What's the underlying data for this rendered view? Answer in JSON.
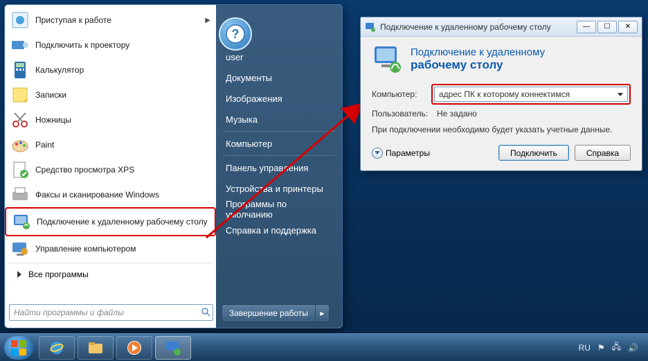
{
  "start_menu": {
    "programs": [
      {
        "label": "Приступая к работе",
        "icon": "getting-started",
        "has_submenu": true
      },
      {
        "label": "Подключить к проектору",
        "icon": "projector"
      },
      {
        "label": "Калькулятор",
        "icon": "calculator"
      },
      {
        "label": "Записки",
        "icon": "sticky-notes"
      },
      {
        "label": "Ножницы",
        "icon": "scissors"
      },
      {
        "label": "Paint",
        "icon": "paint"
      },
      {
        "label": "Средство просмотра XPS",
        "icon": "xps"
      },
      {
        "label": "Факсы и сканирование Windows",
        "icon": "fax"
      },
      {
        "label": "Подключение к удаленному рабочему столу",
        "icon": "rdp",
        "highlight": true
      },
      {
        "label": "Управление компьютером",
        "icon": "mgmt"
      }
    ],
    "all_programs": "Все программы",
    "search_placeholder": "Найти программы и файлы",
    "right_items_top": [
      "user",
      "Документы",
      "Изображения",
      "Музыка"
    ],
    "right_items_mid": [
      "Компьютер"
    ],
    "right_items_bot": [
      "Панель управления",
      "Устройства и принтеры",
      "Программы по умолчанию",
      "Справка и поддержка"
    ],
    "shutdown": "Завершение работы"
  },
  "rdp": {
    "title": "Подключение к удаленному рабочему столу",
    "header_line1": "Подключение к удаленному",
    "header_line2": "рабочему столу",
    "computer_label": "Компьютер:",
    "computer_value": "адрес ПК к которому коннектимся",
    "user_label": "Пользователь:",
    "user_value": "Не задано",
    "note": "При подключении необходимо будет указать учетные данные.",
    "params": "Параметры",
    "connect": "Подключить",
    "help": "Справка"
  },
  "taskbar": {
    "lang": "RU"
  },
  "colors": {
    "highlight": "#d60000",
    "accent": "#0b5ab0"
  }
}
